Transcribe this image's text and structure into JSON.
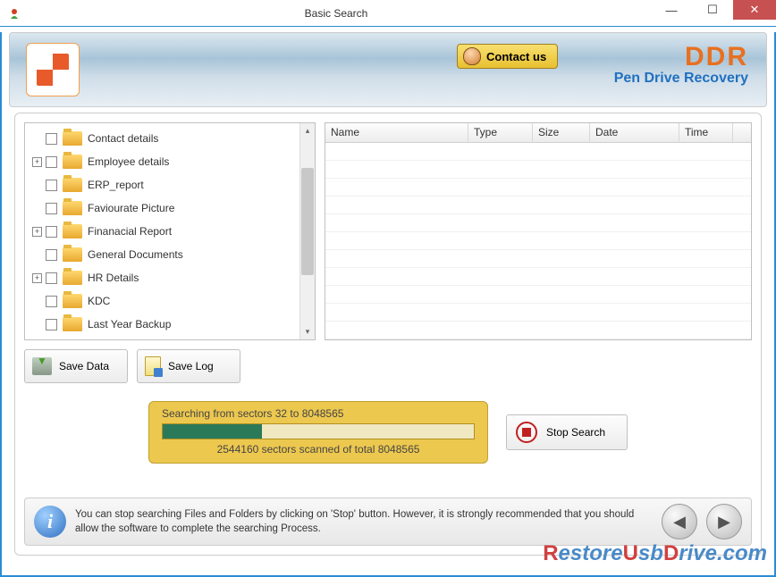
{
  "window": {
    "title": "Basic Search"
  },
  "header": {
    "contact_label": "Contact us",
    "brand": "DDR",
    "brand_subtitle": "Pen Drive Recovery"
  },
  "tree": {
    "items": [
      {
        "label": "Contact details",
        "expander": ""
      },
      {
        "label": "Employee details",
        "expander": "+"
      },
      {
        "label": "ERP_report",
        "expander": ""
      },
      {
        "label": "Faviourate Picture",
        "expander": ""
      },
      {
        "label": "Finanacial Report",
        "expander": "+"
      },
      {
        "label": "General Documents",
        "expander": ""
      },
      {
        "label": "HR Details",
        "expander": "+"
      },
      {
        "label": "KDC",
        "expander": ""
      },
      {
        "label": "Last Year Backup",
        "expander": ""
      }
    ]
  },
  "list": {
    "columns": [
      {
        "label": "Name",
        "width": 160
      },
      {
        "label": "Type",
        "width": 72
      },
      {
        "label": "Size",
        "width": 64
      },
      {
        "label": "Date",
        "width": 100
      },
      {
        "label": "Time",
        "width": 60
      }
    ]
  },
  "buttons": {
    "save_data": "Save Data",
    "save_log": "Save Log",
    "stop_search": "Stop Search"
  },
  "progress": {
    "top_text": "Searching from sectors 32 to 8048565",
    "bottom_text": "2544160  sectors scanned of total 8048565",
    "percent": 32
  },
  "info": {
    "text": "You can stop searching Files and Folders by clicking on 'Stop' button. However, it is strongly recommended that you should allow the software to complete the searching Process."
  },
  "watermark": {
    "r": "R",
    "mid": "estore",
    "u": "U",
    "sb": "sb",
    "d": "D",
    "rive": "rive",
    "ext": ".com"
  }
}
